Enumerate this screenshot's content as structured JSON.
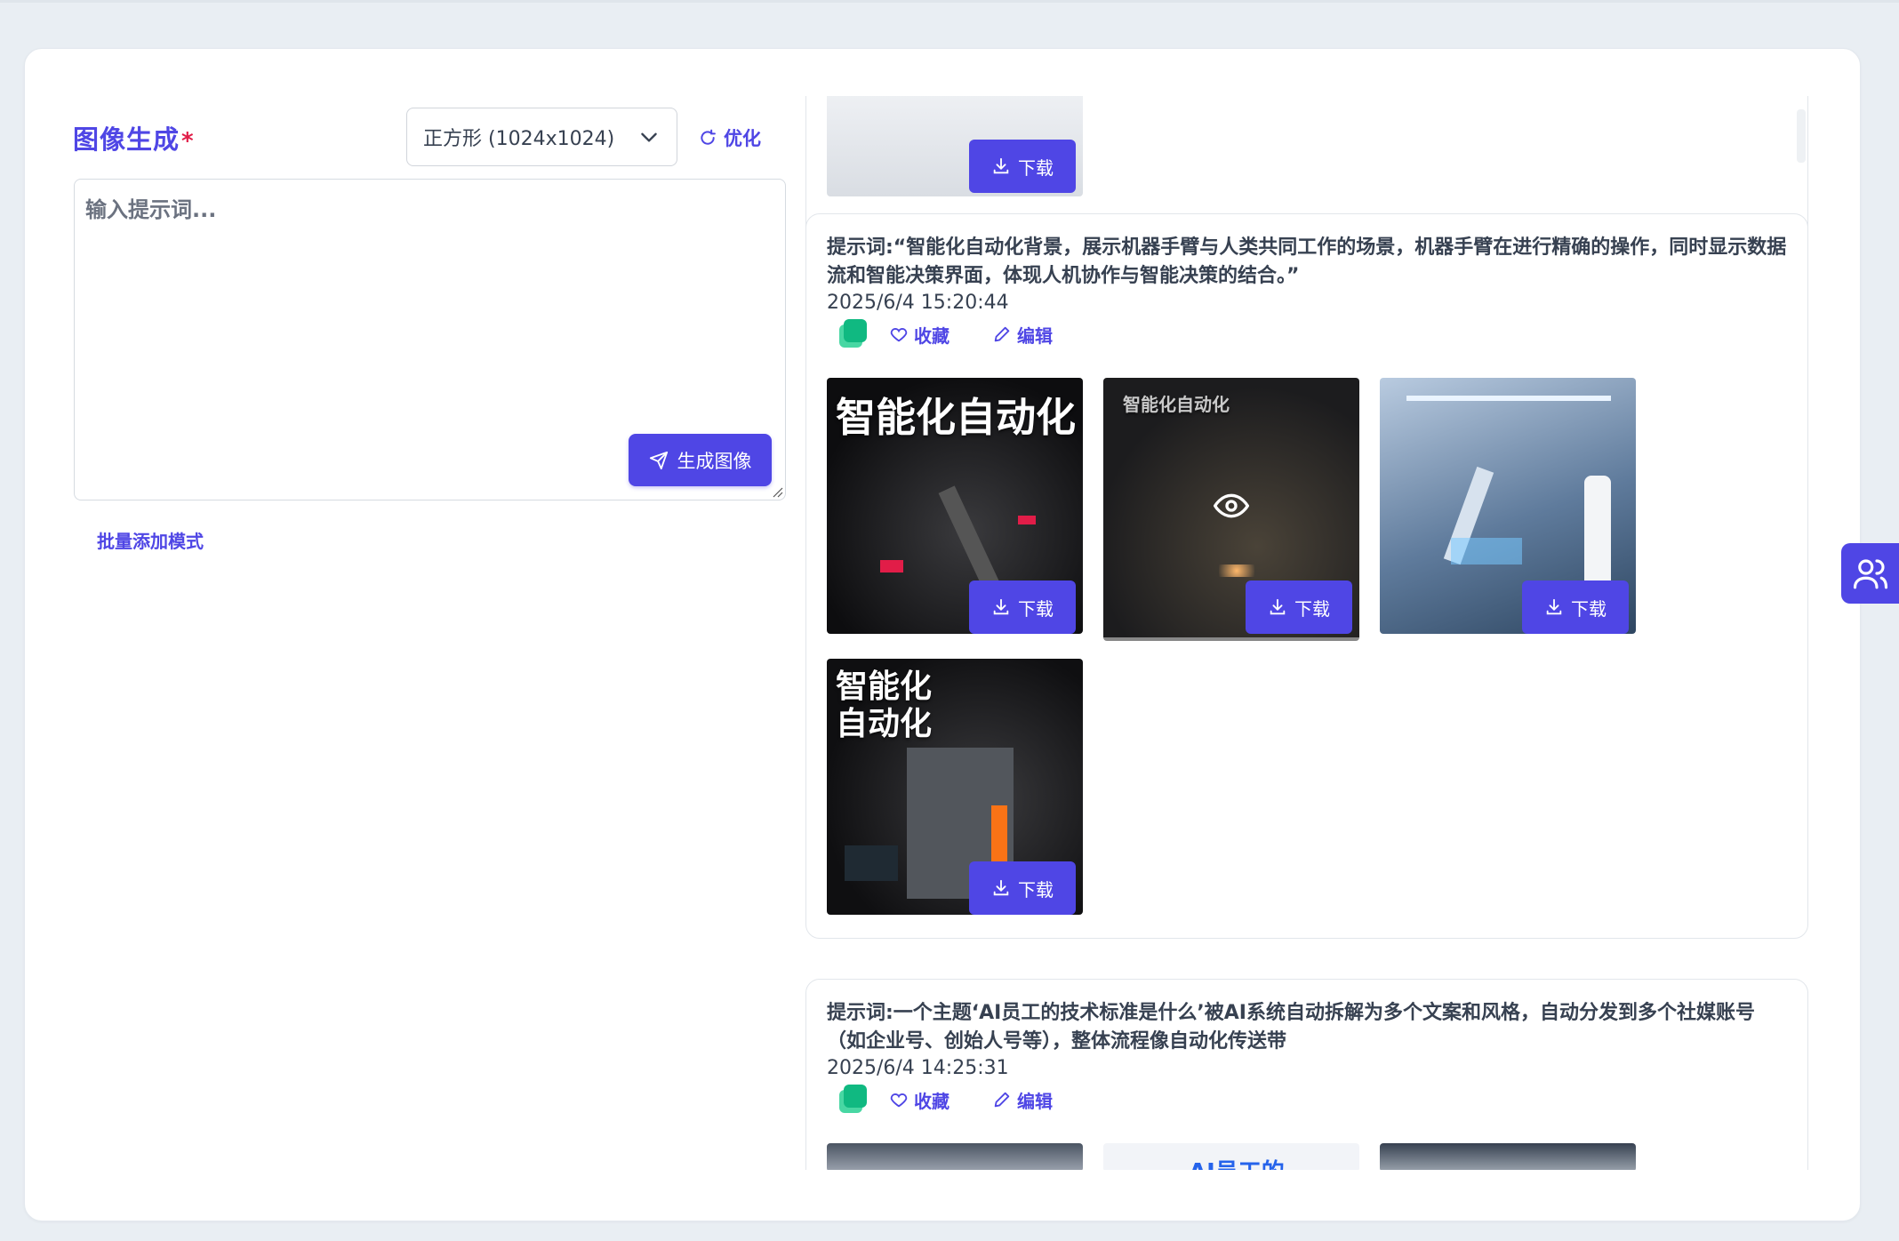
{
  "generator": {
    "title": "图像生成",
    "required_mark": "*",
    "size_select": {
      "value": "正方形 (1024x1024)"
    },
    "optimize_label": "优化",
    "prompt_placeholder": "输入提示词...",
    "generate_label": "生成图像",
    "batch_mode_label": "批量添加模式"
  },
  "history": [
    {
      "download_label": "下载"
    },
    {
      "prompt": "提示词:“智能化自动化背景，展示机器手臂与人类共同工作的场景，机器手臂在进行精确的操作，同时显示数据流和智能决策界面，体现人机协作与智能决策的结合。”",
      "time": "2025/6/4 15:20:44",
      "favorite_label": "收藏",
      "edit_label": "编辑",
      "images": [
        {
          "caption": "智能化自动化",
          "download_label": "下载"
        },
        {
          "caption": "智能化自动化",
          "download_label": "下载"
        },
        {
          "caption": "",
          "download_label": "下载"
        },
        {
          "caption": "智能化自动化",
          "download_label": "下载"
        }
      ]
    },
    {
      "prompt": "提示词:一个主题‘AI员工的技术标准是什么’被AI系统自动拆解为多个文案和风格，自动分发到多个社媒账号（如企业号、创始人号等），整体流程像自动化传送带",
      "time": "2025/6/4 14:25:31",
      "favorite_label": "收藏",
      "edit_label": "编辑",
      "images": [
        {
          "caption": ""
        },
        {
          "caption": "AI员工的"
        },
        {
          "caption": ""
        }
      ]
    }
  ],
  "colors": {
    "accent": "#4f46e5",
    "required": "#e11d48",
    "green": "#10b981"
  }
}
